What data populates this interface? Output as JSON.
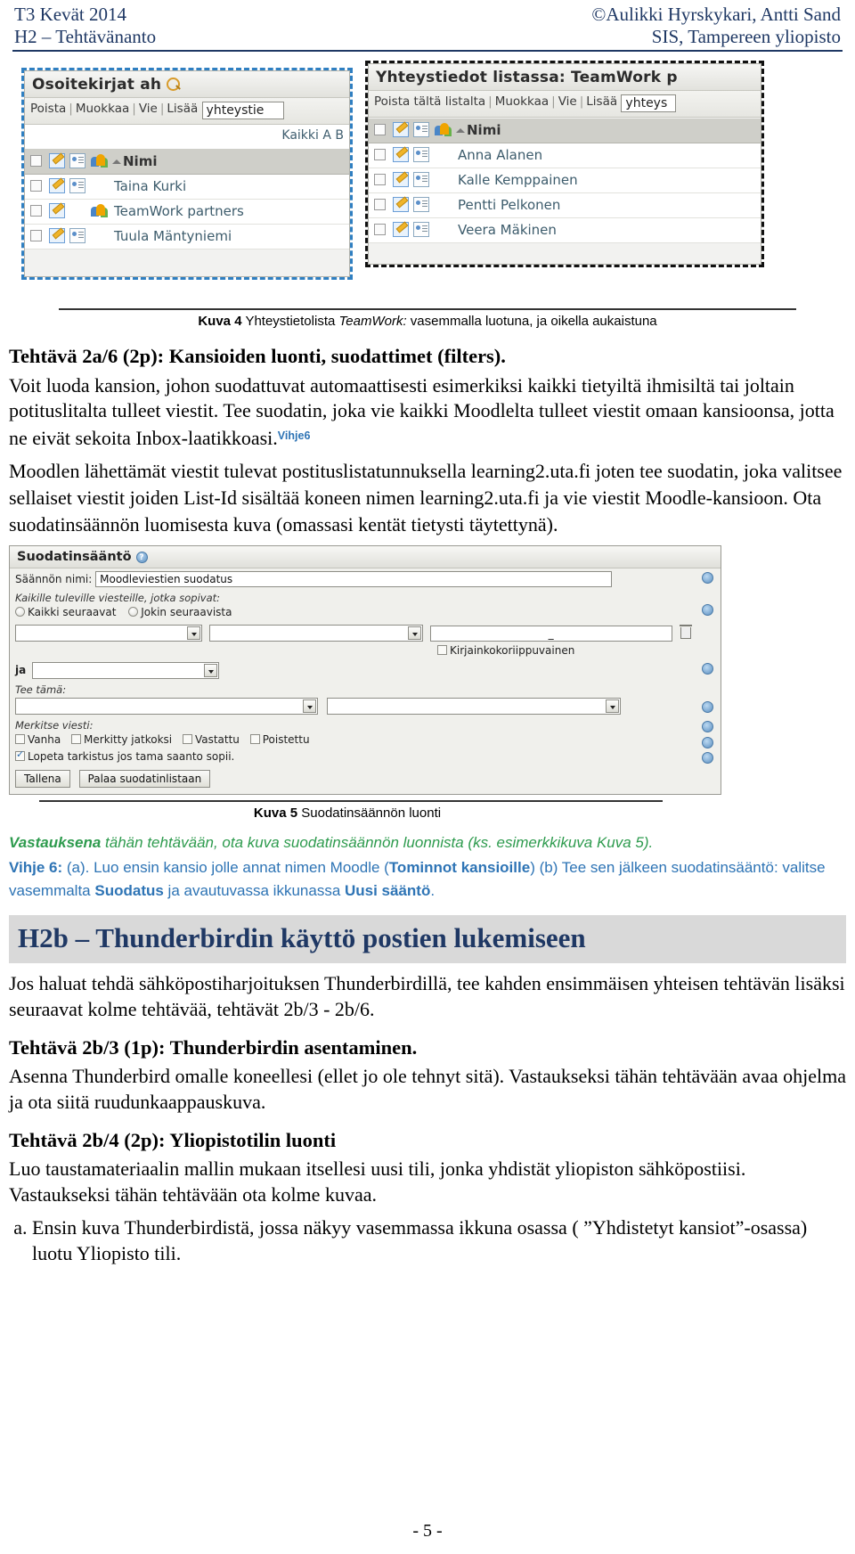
{
  "header": {
    "left_line1": "T3 Kevät 2014",
    "left_line2": "H2 – Tehtävänanto",
    "right_line1": "©Aulikki Hyrskykari, Antti Sand",
    "right_line2": "SIS, Tampereen yliopisto"
  },
  "figure4": {
    "left_panel": {
      "title": "Osoitekirjat ah",
      "search_icon": "magnify-icon",
      "toolbar": [
        "Poista",
        "Muokkaa",
        "Vie",
        "Lisää"
      ],
      "search_value": "yhteystie",
      "alpha_label": "Kaikki A B",
      "column_header": "Nimi",
      "rows": [
        "Taina Kurki",
        "TeamWork partners",
        "Tuula Mäntyniemi"
      ]
    },
    "right_panel": {
      "title": "Yhteystiedot listassa: TeamWork p",
      "toolbar": [
        "Poista tältä listalta",
        "Muokkaa",
        "Vie",
        "Lisää"
      ],
      "search_value": "yhteys",
      "column_header": "Nimi",
      "rows": [
        "Anna Alanen",
        "Kalle Kemppainen",
        "Pentti Pelkonen",
        "Veera Mäkinen"
      ]
    },
    "caption_bold": "Kuva 4",
    "caption_pre": " Yhteystietolista ",
    "caption_italic": "TeamWork:",
    "caption_post": " vasemmalla luotuna, ja oikella aukaistuna"
  },
  "task_2a6": {
    "heading": "Tehtävä 2a/6 (2p): Kansioiden luonti, suodattimet (filters).",
    "para1": "Voit luoda kansion, johon suodattuvat automaattisesti esimerkiksi kaikki tietyiltä ihmisiltä tai joltain potituslitalta tulleet viestit. Tee suodatin, joka vie kaikki Moodlelta tulleet viestit omaan kansioonsa, jotta ne eivät sekoita Inbox-laatikkoasi.",
    "vihje_sup": "Vihje6",
    "para2": "Moodlen lähettämät viestit tulevat postituslistatunnuksella learning2.uta.fi joten tee suodatin, joka valitsee sellaiset viestit joiden List-Id sisältää koneen nimen learning2.uta.fi ja vie viestit Moodle-kansioon. Ota suodatinsäännön luomisesta kuva (omassasi kentät tietysti täytettynä)."
  },
  "figure5": {
    "title": "Suodatinsääntö",
    "help_icon": "help-icon",
    "rule_name_label": "Säännön nimi:",
    "rule_name_value": "Moodleviestien suodatus",
    "match_label": "Kaikille tuleville viesteille, jotka sopivat:",
    "radio_all": "Kaikki seuraavat",
    "radio_any": "Jokin seuraavista",
    "case_sensitive_label": "Kirjainkokoriippuvainen",
    "and_label": "ja",
    "do_this_label": "Tee tämä:",
    "mark_message_label": "Merkitse viesti:",
    "mark_options": [
      "Vanha",
      "Merkitty jatkoksi",
      "Vastattu",
      "Poistettu"
    ],
    "stop_check_label": "Lopeta tarkistus jos tama saanto sopii.",
    "buttons": [
      "Tallena",
      "Palaa suodatinlistaan"
    ],
    "trash_icon": "trash-icon",
    "caption_bold": "Kuva 5",
    "caption_rest": " Suodatinsäännön luonti"
  },
  "answer_block": {
    "green_pre": "Vastauksena",
    "green_rest": " tähän tehtävään, ota kuva suodatinsäännön luonnista (ks. esimerkkikuva Kuva 5).",
    "hint_label": "Vihje 6:",
    "hint_text_1": " (a). Luo ensin kansio jolle annat nimen Moodle (",
    "hint_bold_1": "Tominnot kansioille",
    "hint_text_2": ") (b) Tee sen jälkeen suodatinsääntö: valitse vasemmalta ",
    "hint_bold_2": "Suodatus",
    "hint_text_3": " ja avautuvassa ikkunassa ",
    "hint_bold_3": "Uusi sääntö",
    "hint_text_4": "."
  },
  "section_h2b": {
    "banner_title": "H2b – Thunderbirdin käyttö postien lukemiseen",
    "intro": "Jos haluat tehdä sähköpostiharjoituksen Thunderbirdillä, tee kahden ensimmäisen yhteisen tehtävän lisäksi seuraavat kolme tehtävää, tehtävät 2b/3 - 2b/6.",
    "task_2b3_heading": "Tehtävä 2b/3 (1p): Thunderbirdin asentaminen.",
    "task_2b3_body": "Asenna Thunderbird omalle koneellesi (ellet jo ole tehnyt sitä). Vastaukseksi tähän tehtävään avaa ohjelma ja ota siitä ruudunkaappauskuva.",
    "task_2b4_heading": "Tehtävä 2b/4 (2p): Yliopistotilin luonti",
    "task_2b4_body": "Luo taustamateriaalin mallin mukaan itsellesi uusi tili, jonka yhdistät yliopiston sähköpostiisi. Vastaukseksi tähän tehtävään ota kolme kuvaa.",
    "item_a": "Ensin kuva Thunderbirdistä, jossa näkyy vasemmassa ikkuna osassa ( ”Yhdistetyt kansiot”-osassa) luotu Yliopisto tili."
  },
  "footer": {
    "page_number": "- 5 -"
  }
}
